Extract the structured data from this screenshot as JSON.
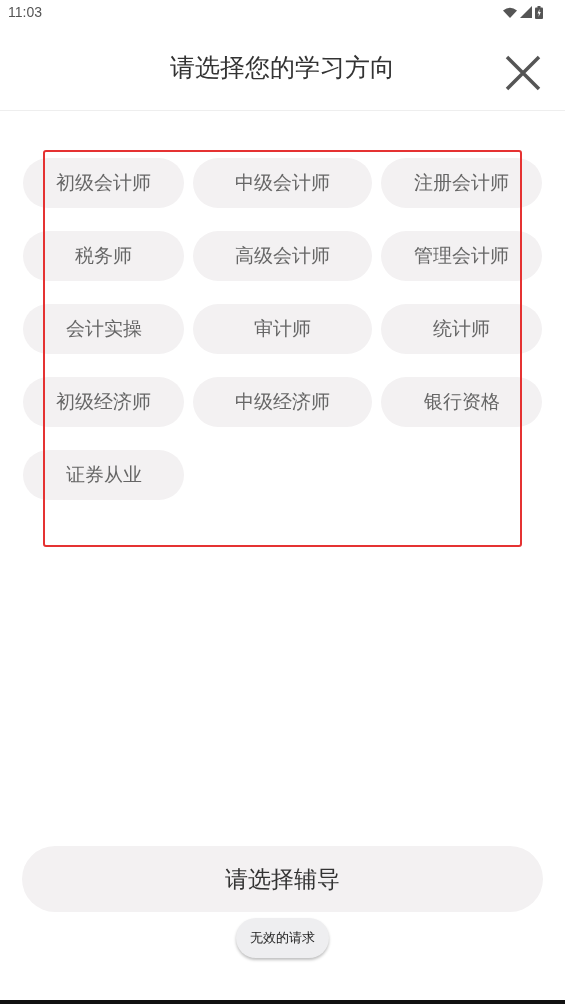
{
  "status_bar": {
    "time": "11:03"
  },
  "header": {
    "title": "请选择您的学习方向"
  },
  "directions": {
    "highlighted": true,
    "items": [
      {
        "label": "初级会计师",
        "selected": false
      },
      {
        "label": "中级会计师",
        "selected": false
      },
      {
        "label": "注册会计师",
        "selected": false
      },
      {
        "label": "税务师",
        "selected": false
      },
      {
        "label": "高级会计师",
        "selected": false
      },
      {
        "label": "管理会计师",
        "selected": false
      },
      {
        "label": "会计实操",
        "selected": false
      },
      {
        "label": "审计师",
        "selected": false
      },
      {
        "label": "统计师",
        "selected": false
      },
      {
        "label": "初级经济师",
        "selected": false
      },
      {
        "label": "中级经济师",
        "selected": false
      },
      {
        "label": "银行资格",
        "selected": false
      },
      {
        "label": "证券从业",
        "selected": false
      }
    ]
  },
  "confirm_button": {
    "label": "请选择辅导"
  },
  "toast": {
    "message": "无效的请求"
  }
}
